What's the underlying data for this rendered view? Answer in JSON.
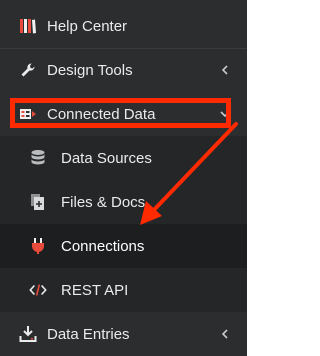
{
  "sidebar": {
    "items": [
      {
        "label": "Help Center",
        "icon": "help-center-icon",
        "level": "top"
      },
      {
        "label": "Design Tools",
        "icon": "wrench-icon",
        "level": "top",
        "caret": "left"
      },
      {
        "label": "Connected Data",
        "icon": "connected-data-icon",
        "level": "top",
        "caret": "down",
        "state": "expanded"
      },
      {
        "label": "Data Sources",
        "icon": "database-icon",
        "level": "sub"
      },
      {
        "label": "Files & Docs",
        "icon": "files-icon",
        "level": "sub"
      },
      {
        "label": "Connections",
        "icon": "plug-icon",
        "level": "sub",
        "state": "active"
      },
      {
        "label": "REST API",
        "icon": "code-icon",
        "level": "sub"
      },
      {
        "label": "Data Entries",
        "icon": "download-icon",
        "level": "top",
        "caret": "left"
      }
    ]
  },
  "annotation": {
    "highlight_color": "#ff2a00",
    "arrow_color": "#ff2a00",
    "highlighted_item": "Connected Data",
    "arrow_target": "Connections"
  },
  "colors": {
    "sidebar_bg": "#2b2d2f",
    "submenu_bg": "#242628",
    "active_bg": "#1d1e20",
    "text": "#e9ebec",
    "brand_red": "#e84a3c"
  }
}
